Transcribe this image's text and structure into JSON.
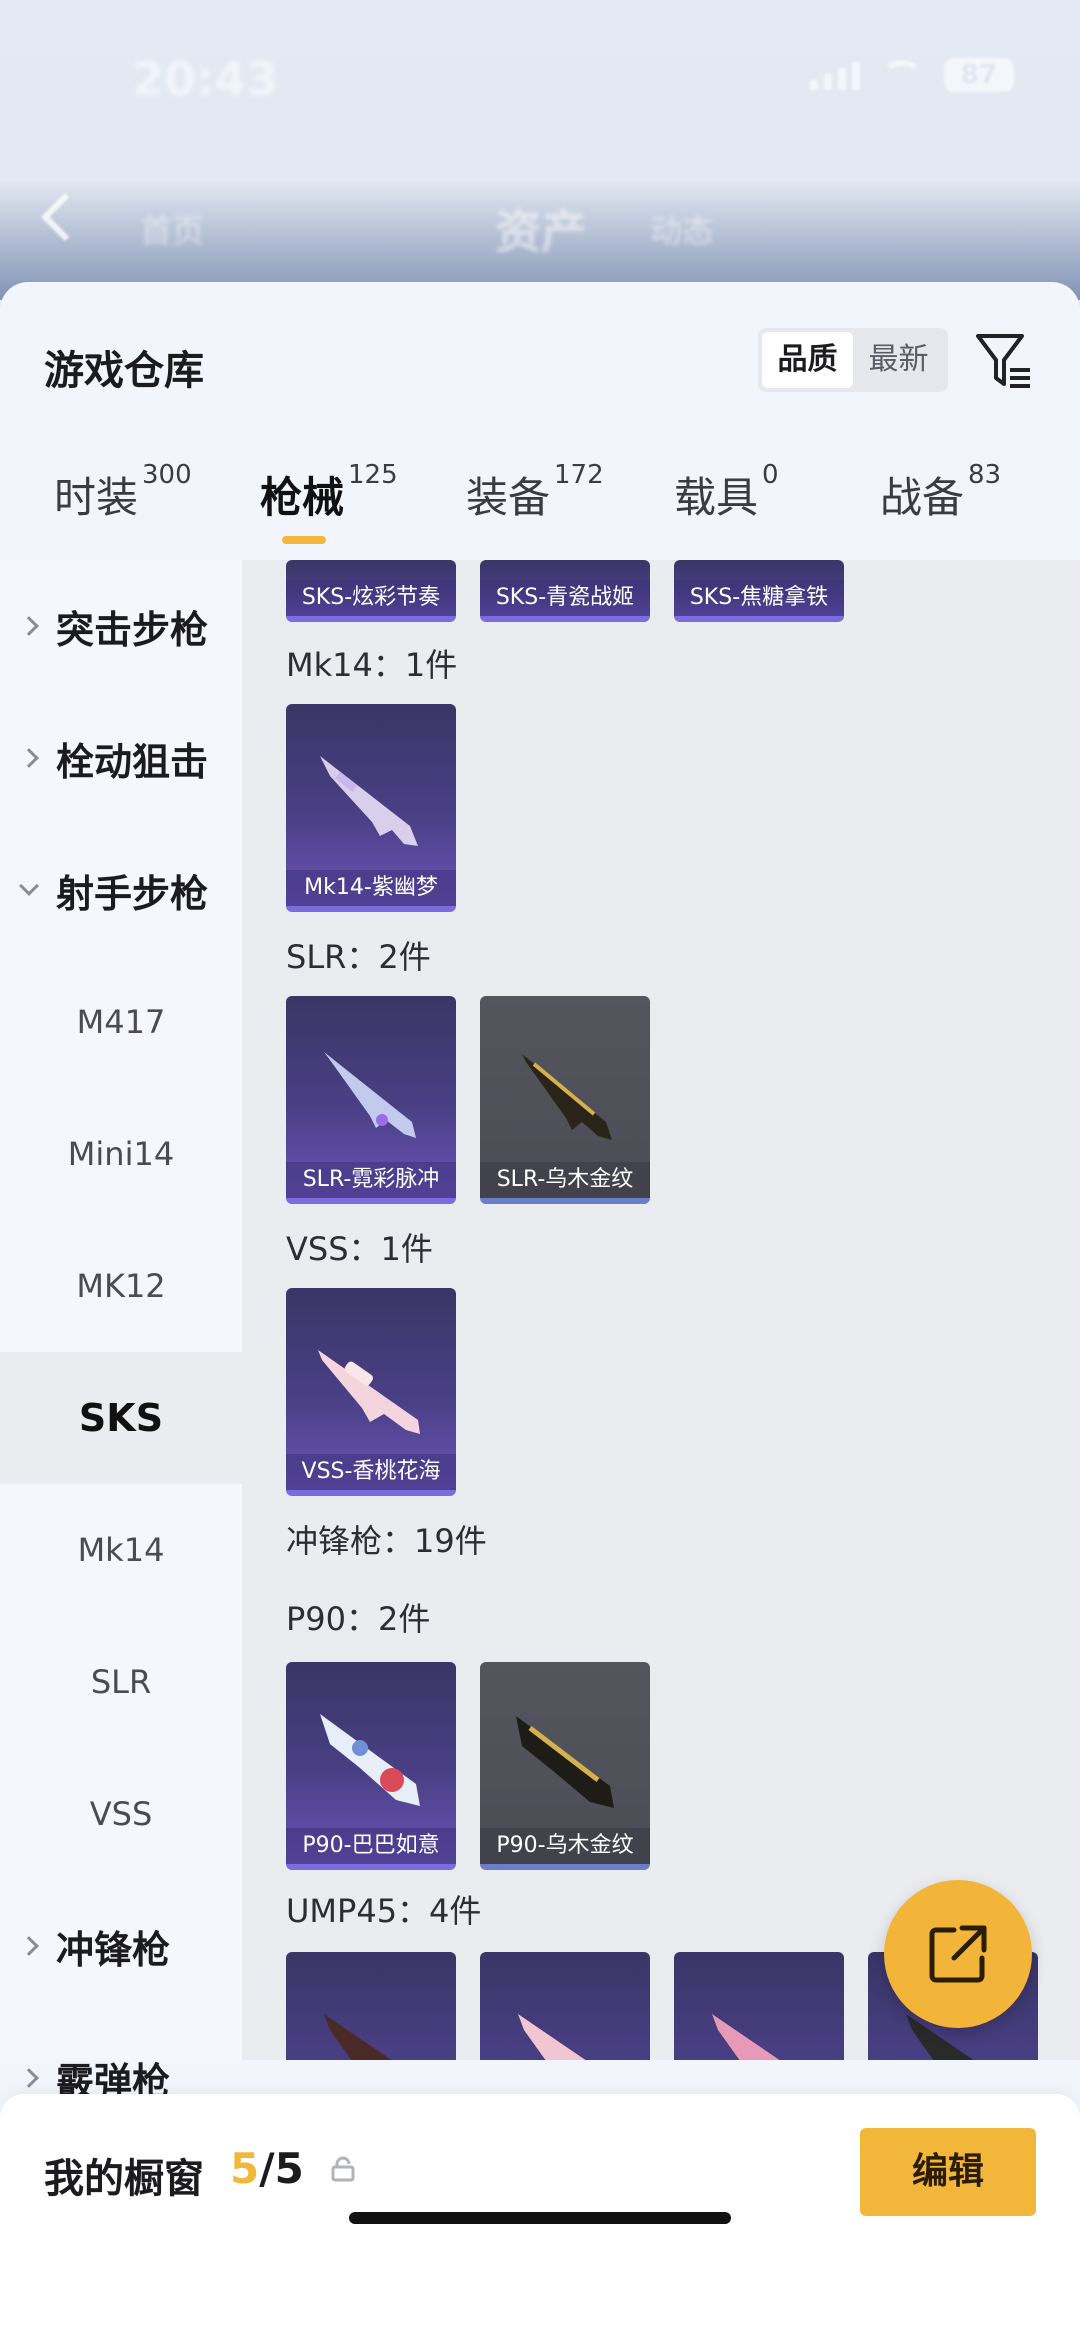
{
  "status_bar": {
    "time": "20:43",
    "battery": "87"
  },
  "header": {
    "title": "资产",
    "left_ghost": "首页",
    "right_ghost": "动态"
  },
  "warehouse": {
    "title": "游戏仓库",
    "sort_options": [
      "品质",
      "最新"
    ],
    "active_sort": "品质"
  },
  "tabs": [
    {
      "label": "时装",
      "count": "300"
    },
    {
      "label": "枪械",
      "count": "125"
    },
    {
      "label": "装备",
      "count": "172"
    },
    {
      "label": "载具",
      "count": "0"
    },
    {
      "label": "战备",
      "count": "83"
    }
  ],
  "active_tab": "枪械",
  "sidebar": {
    "items": [
      {
        "label": "突击步枪",
        "type": "category",
        "expanded": false
      },
      {
        "label": "栓动狙击",
        "type": "category",
        "expanded": false
      },
      {
        "label": "射手步枪",
        "type": "category",
        "expanded": true
      },
      {
        "label": "M417",
        "type": "sub"
      },
      {
        "label": "Mini14",
        "type": "sub"
      },
      {
        "label": "MK12",
        "type": "sub"
      },
      {
        "label": "SKS",
        "type": "sub",
        "selected": true
      },
      {
        "label": "Mk14",
        "type": "sub"
      },
      {
        "label": "SLR",
        "type": "sub"
      },
      {
        "label": "VSS",
        "type": "sub"
      },
      {
        "label": "冲锋枪",
        "type": "category",
        "expanded": false
      },
      {
        "label": "霰弹枪",
        "type": "category",
        "expanded": false
      }
    ]
  },
  "content": {
    "top_cards": [
      "SKS-炫彩节奏",
      "SKS-青瓷战姬",
      "SKS-焦糖拿铁"
    ],
    "groups": [
      {
        "label": "Mk14：1件",
        "cards": [
          "Mk14-紫幽梦"
        ]
      },
      {
        "label": "SLR：2件",
        "cards": [
          "SLR-霓彩脉冲",
          "SLR-乌木金纹"
        ]
      },
      {
        "label": "VSS：1件",
        "cards": [
          "VSS-香桃花海"
        ]
      },
      {
        "label": "冲锋枪：19件"
      },
      {
        "label": "P90：2件",
        "cards": [
          "P90-巴巴如意",
          "P90-乌木金纹"
        ]
      },
      {
        "label": "UMP45：4件"
      }
    ]
  },
  "showcase": {
    "label": "我的橱窗",
    "used": "5",
    "total": "/5",
    "edit_label": "编辑"
  },
  "colors": {
    "accent": "#f2b73a",
    "purple_card": "#4a3f85",
    "gray_card": "#4b4c55"
  }
}
